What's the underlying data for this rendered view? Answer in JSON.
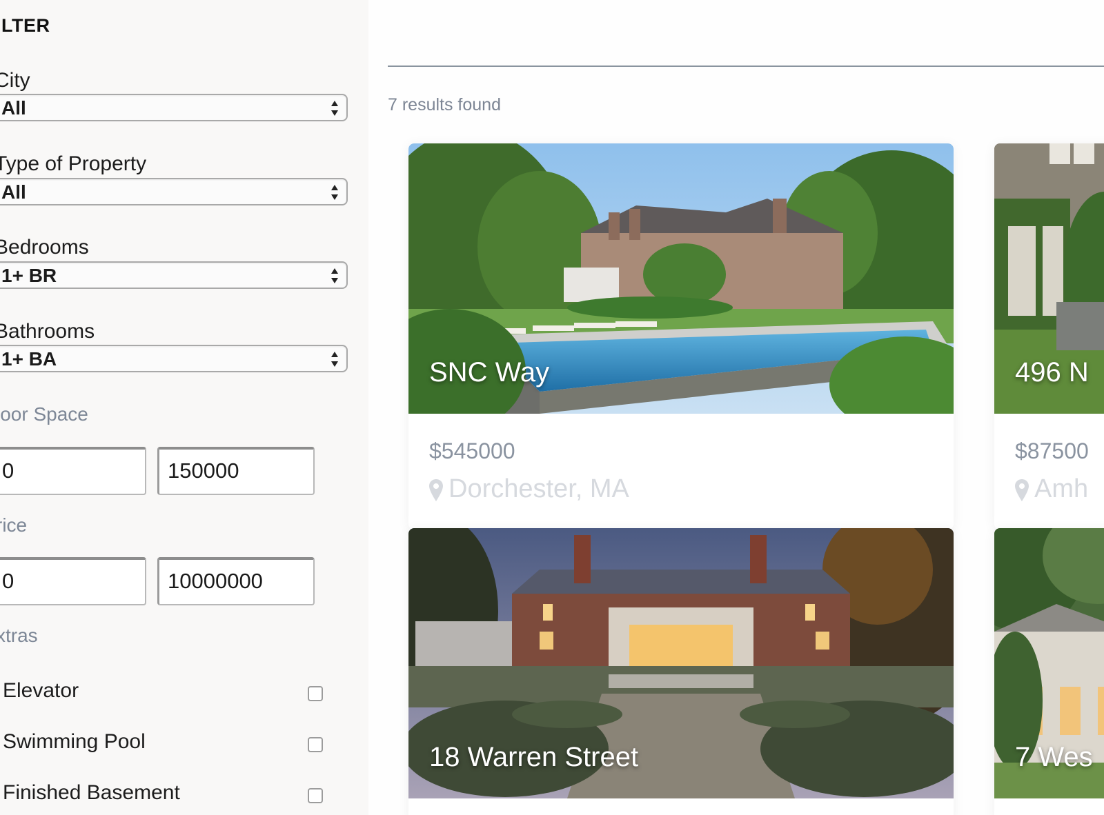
{
  "filter": {
    "title": "ILTER",
    "city": {
      "label": "City",
      "value": "All"
    },
    "type": {
      "label": "Type of Property",
      "value": "All"
    },
    "bedrooms": {
      "label": "Bedrooms",
      "value": "1+ BR"
    },
    "bathrooms": {
      "label": "Bathrooms",
      "value": "1+ BA"
    },
    "floor_space": {
      "label": "loor Space",
      "min": "0",
      "max": "150000"
    },
    "price": {
      "label": "rice",
      "min": "0",
      "max": "10000000"
    },
    "extras": {
      "label": "xtras",
      "items": [
        {
          "label": "Elevator",
          "checked": false
        },
        {
          "label": "Swimming Pool",
          "checked": false
        },
        {
          "label": "Finished Basement",
          "checked": false
        }
      ]
    }
  },
  "results": {
    "count_text": "7 results found",
    "listings": [
      {
        "title": "SNC Way",
        "price": "$545000",
        "location": "Dorchester, MA",
        "image": "mansion-with-pool"
      },
      {
        "title": "496 N",
        "price": "$87500",
        "location": "Amh",
        "image": "ivy-covered-house"
      },
      {
        "title": "18 Warren Street",
        "price": "",
        "location": "",
        "image": "brick-estate-dusk"
      },
      {
        "title": "7 Wes",
        "price": "",
        "location": "",
        "image": "white-house-trees"
      }
    ]
  },
  "colors": {
    "sidebar_bg": "#f9f8f7",
    "muted_text": "#7c8594",
    "location_text": "#d6d9de"
  }
}
